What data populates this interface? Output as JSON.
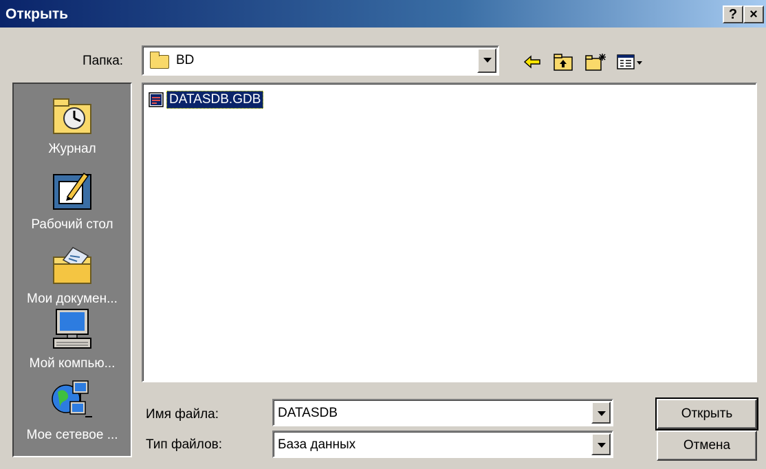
{
  "window": {
    "title": "Открыть",
    "help_label": "?",
    "close_label": "×"
  },
  "lookin": {
    "label": "Папка:",
    "value": "BD"
  },
  "toolbar": {
    "icons": [
      "back-arrow-icon",
      "up-folder-icon",
      "new-folder-icon",
      "view-menu-icon"
    ]
  },
  "places": [
    {
      "label": "Журнал",
      "icon": "history-icon"
    },
    {
      "label": "Рабочий стол",
      "icon": "desktop-icon"
    },
    {
      "label": "Мои докумен...",
      "icon": "my-documents-icon"
    },
    {
      "label": "Мой компью...",
      "icon": "my-computer-icon"
    },
    {
      "label": "Мое сетевое ...",
      "icon": "network-icon"
    }
  ],
  "files": [
    {
      "name": "DATASDB.GDB",
      "icon": "database-file-icon",
      "selected": true
    }
  ],
  "filename": {
    "label": "Имя файла:",
    "value": "DATASDB"
  },
  "filetype": {
    "label": "Тип файлов:",
    "value": "База данных"
  },
  "buttons": {
    "open": "Открыть",
    "cancel": "Отмена"
  },
  "colors": {
    "title_start": "#0a246a",
    "title_end": "#a6caf0",
    "selection": "#0a246a",
    "face": "#d4d0c8",
    "places_bg": "#808080"
  }
}
